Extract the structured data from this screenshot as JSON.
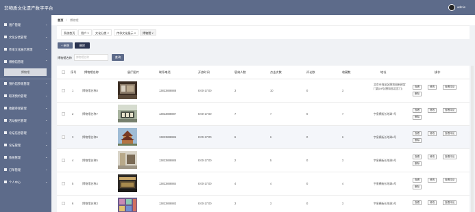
{
  "header": {
    "title": "非物质文化遗产数字平台",
    "username": "admin"
  },
  "sidebar": {
    "items": [
      {
        "label": "用户管理"
      },
      {
        "label": "文化分类管理"
      },
      {
        "label": "传承文化展示管理"
      },
      {
        "label": "博物馆管理"
      },
      {
        "label": "预约馆参观管理"
      },
      {
        "label": "取消预约管理"
      },
      {
        "label": "收藏参观管理"
      },
      {
        "label": "活动报名管理"
      },
      {
        "label": "论坛信息管理"
      },
      {
        "label": "论坛管理"
      },
      {
        "label": "系统管理"
      },
      {
        "label": "订单管理"
      },
      {
        "label": "个人中心"
      }
    ],
    "active_sub": "博物馆"
  },
  "breadcrumb": {
    "home": "首页",
    "separator": "/",
    "current": "博物馆"
  },
  "tags": [
    "系统首页",
    "用户 ×",
    "文化分类 ×",
    "传承文化展示 ×",
    "博物馆 ×"
  ],
  "toolbar": {
    "add": "+ 新增",
    "delete": "删除",
    "search_label": "博物馆名称",
    "search_placeholder": "博物馆名称",
    "search_button": "查询"
  },
  "table": {
    "headers": [
      "序号",
      "博物馆名称",
      "展厅图片",
      "联系电话",
      "开放时间",
      "容纳人数",
      "点击次数",
      "评论数",
      "收藏数",
      "地址",
      "操作"
    ],
    "rows": [
      {
        "index": "1",
        "name": "博物馆名称8",
        "phone": "13823888888",
        "time": "8:00-17:00",
        "capacity": "3",
        "clicks": "10",
        "comments": "0",
        "favs": "3",
        "address": "北京市海淀区颐和园新建宫门路19号(颐和园北宫门)"
      },
      {
        "index": "2",
        "name": "博物馆名称7",
        "phone": "13823888887",
        "time": "8:00-17:00",
        "capacity": "7",
        "clicks": "7",
        "comments": "0",
        "favs": "7",
        "address": "宇泉横街长地球7号"
      },
      {
        "index": "3",
        "name": "博物馆名称6",
        "phone": "13823888886",
        "time": "8:00-17:00",
        "capacity": "6",
        "clicks": "6",
        "comments": "0",
        "favs": "6",
        "address": "宇泉横街长地球6号"
      },
      {
        "index": "4",
        "name": "博物馆名称5",
        "phone": "13823888885",
        "time": "8:00-17:00",
        "capacity": "2",
        "clicks": "5",
        "comments": "0",
        "favs": "3",
        "address": "宇泉横街长地球5号"
      },
      {
        "index": "5",
        "name": "博物馆名称4",
        "phone": "13823888884",
        "time": "8:00-17:00",
        "capacity": "4",
        "clicks": "4",
        "comments": "0",
        "favs": "4",
        "address": "宇泉横街长地球4号"
      },
      {
        "index": "6",
        "name": "博物馆名称3",
        "phone": "13823888883",
        "time": "8:00-17:00",
        "capacity": "3",
        "clicks": "3",
        "comments": "0",
        "favs": "3",
        "address": "宇泉横街长地球3号"
      }
    ],
    "ops": {
      "view": "查看",
      "edit": "修改",
      "view_comments": "查看评论",
      "delete": "删除"
    }
  }
}
